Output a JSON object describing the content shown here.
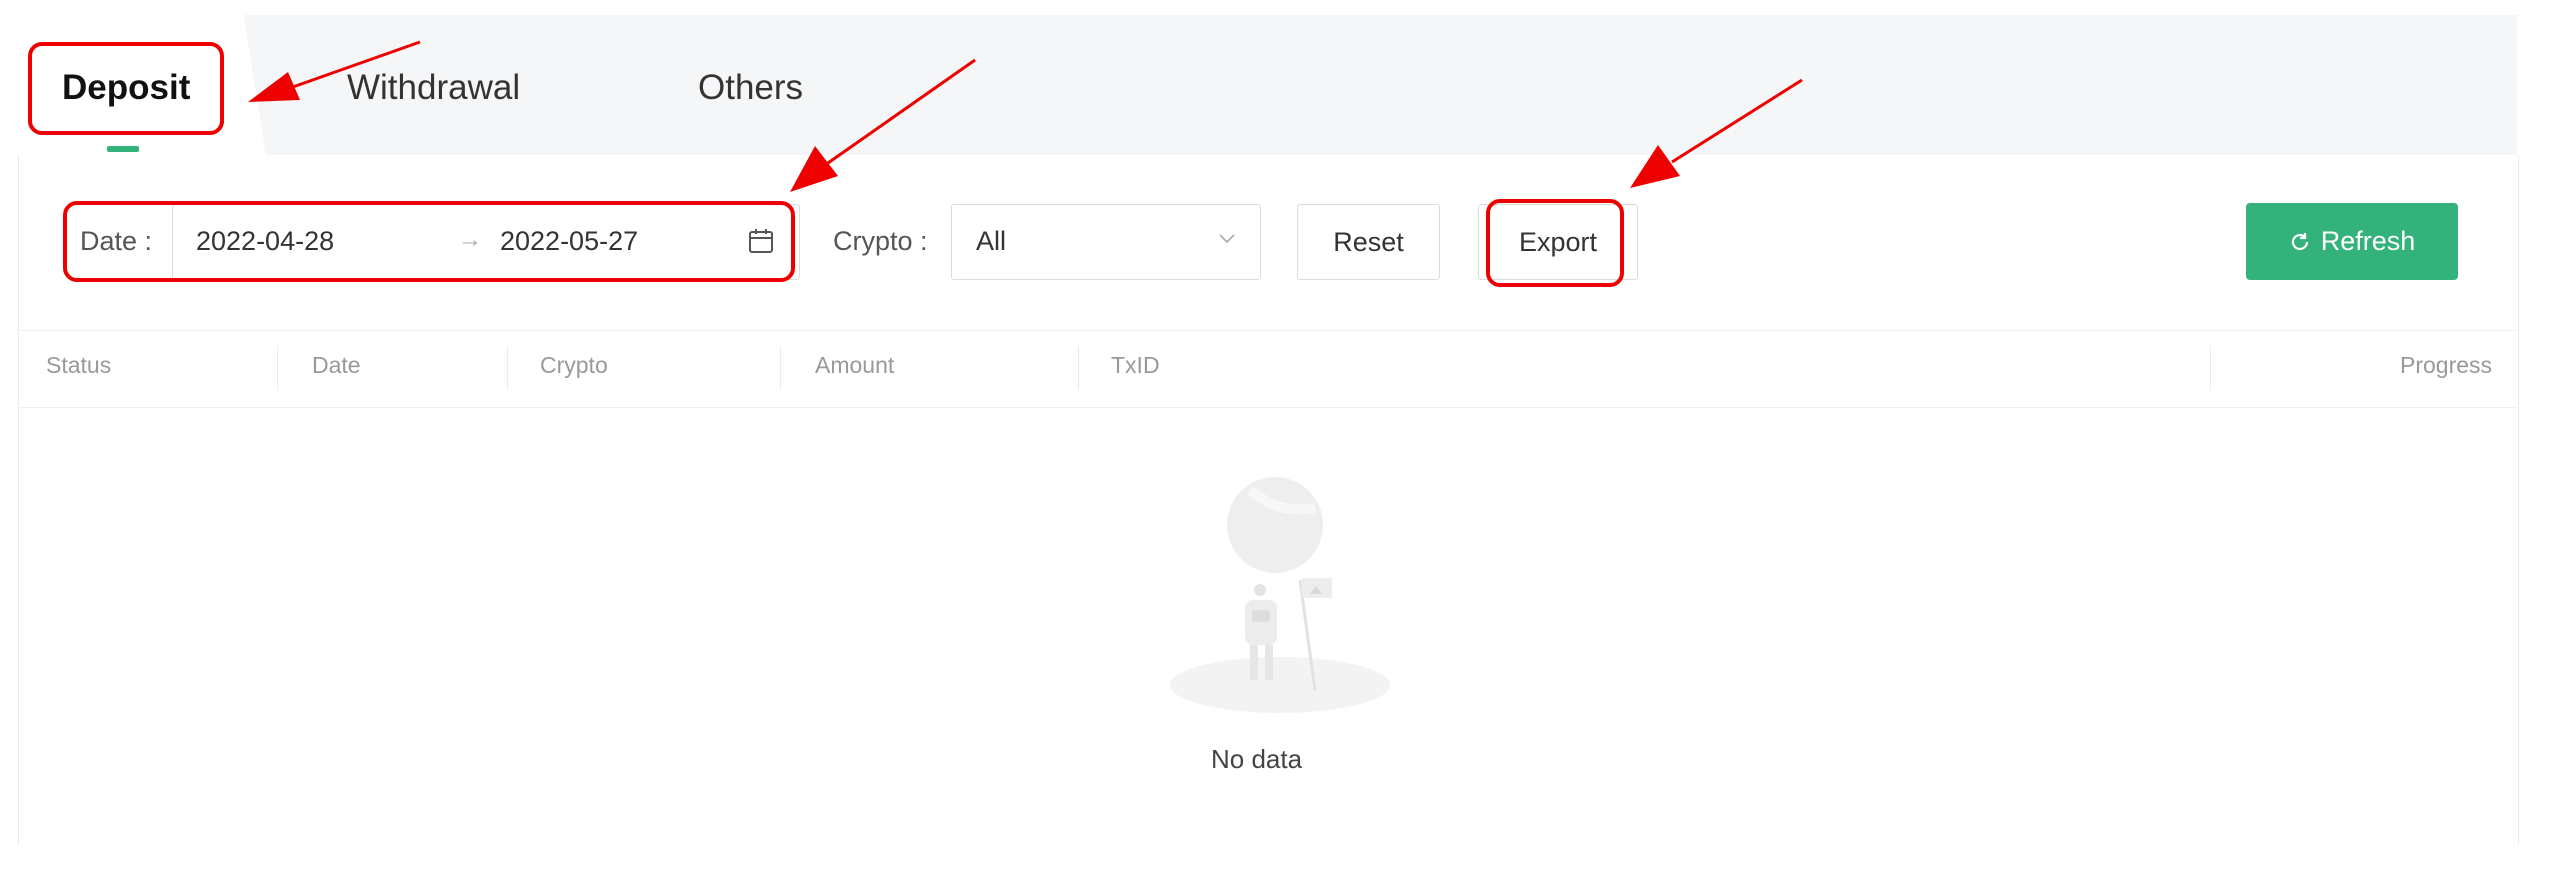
{
  "tabs": [
    {
      "label": "Deposit",
      "active": true
    },
    {
      "label": "Withdrawal",
      "active": false
    },
    {
      "label": "Others",
      "active": false
    }
  ],
  "filters": {
    "date_label": "Date :",
    "date_start": "2022-04-28",
    "date_separator": "→",
    "date_end": "2022-05-27",
    "crypto_label": "Crypto :",
    "crypto_value": "All"
  },
  "buttons": {
    "reset": "Reset",
    "export": "Export",
    "refresh": "Refresh"
  },
  "table": {
    "columns": [
      "Status",
      "Date",
      "Crypto",
      "Amount",
      "TxID",
      "Progress"
    ]
  },
  "empty": {
    "message": "No data"
  },
  "colors": {
    "accent": "#34b27b",
    "annotation": "#ee0000"
  },
  "icons": [
    "calendar-icon",
    "chevron-down-icon",
    "refresh-icon",
    "empty-state-illustration"
  ]
}
